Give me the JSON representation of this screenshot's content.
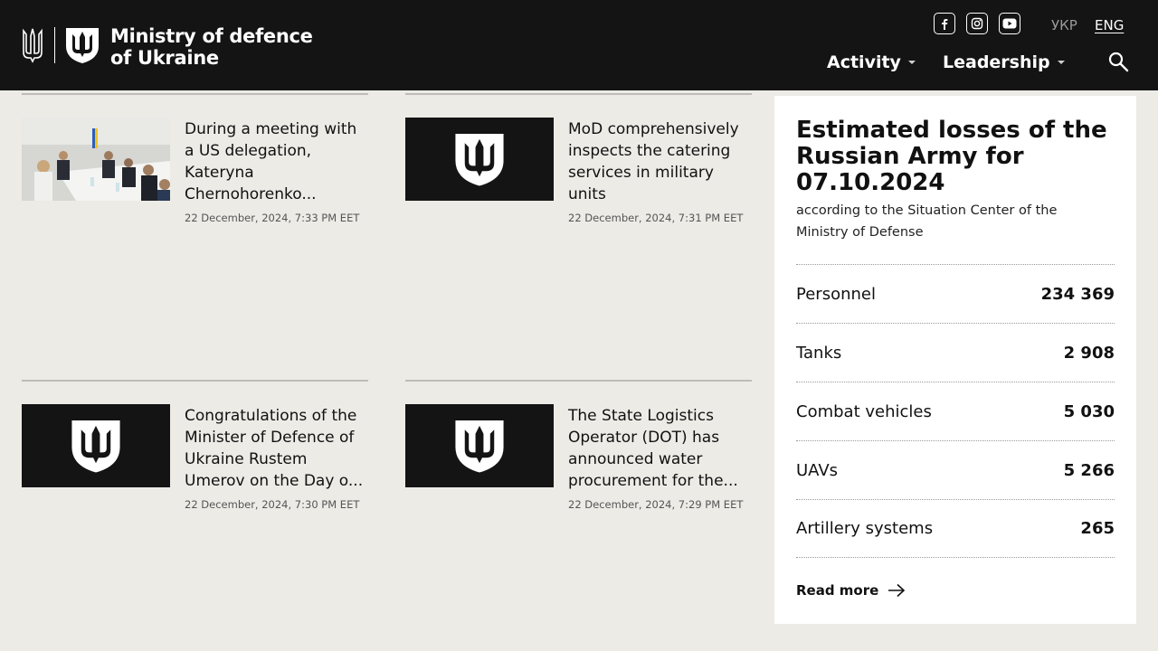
{
  "header": {
    "logo_line1": "Ministry of defence",
    "logo_line2": "of Ukraine",
    "social": [
      "facebook-icon",
      "instagram-icon",
      "youtube-icon"
    ],
    "languages": {
      "ukr": "УКР",
      "eng": "ENG",
      "active": "ENG"
    },
    "nav": [
      {
        "label": "Activity"
      },
      {
        "label": "Leadership"
      }
    ]
  },
  "news": [
    {
      "title": "During a meeting with a US delegation, Kateryna Chernohorenko...",
      "date": "22 December, 2024, 7:33 PM EET",
      "image": "photo"
    },
    {
      "title": "MoD comprehensively inspects the catering services in military units",
      "date": "22 December, 2024, 7:31 PM EET",
      "image": "emblem"
    },
    {
      "title": "Congratulations of the Minister of Defence of Ukraine Rustem Umerov on the Day o...",
      "date": "22 December, 2024, 7:30 PM EET",
      "image": "emblem"
    },
    {
      "title": "The State Logistics Operator (DOT) has announced water procurement for the...",
      "date": "22 December, 2024, 7:29 PM EET",
      "image": "emblem"
    }
  ],
  "losses": {
    "title": "Estimated losses of the Russian Army for 07.10.2024",
    "subtitle": "according to the Situation Center of the Ministry of Defense",
    "rows": [
      {
        "label": "Personnel",
        "value": "234 369"
      },
      {
        "label": "Tanks",
        "value": "2 908"
      },
      {
        "label": "Combat vehicles",
        "value": "5 030"
      },
      {
        "label": "UAVs",
        "value": "5 266"
      },
      {
        "label": "Artillery systems",
        "value": "265"
      }
    ],
    "read_more": "Read more"
  },
  "colors": {
    "header_bg": "#141414",
    "page_bg": "#ecebe6",
    "panel_bg": "#ffffff"
  }
}
